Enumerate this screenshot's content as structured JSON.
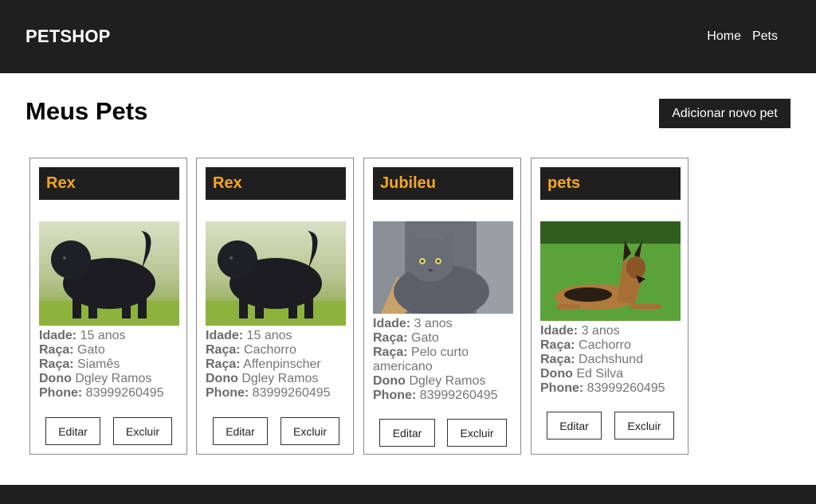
{
  "header": {
    "brand": "PETSHOP",
    "nav": [
      "Home",
      "Pets"
    ]
  },
  "main": {
    "title": "Meus Pets",
    "add_button": "Adicionar novo pet"
  },
  "labels": {
    "idade": "Idade:",
    "raca": "Raça:",
    "dono": "Dono",
    "phone": "Phone:",
    "edit": "Editar",
    "delete": "Excluir"
  },
  "pets": [
    {
      "name": "Rex",
      "photo": "black-shaggy-dog-photo",
      "idade": "15 anos",
      "tipo": "Gato",
      "raca": "Siamês",
      "dono": "Dgley Ramos",
      "phone": "83999260495"
    },
    {
      "name": "Rex",
      "photo": "black-shaggy-dog-photo",
      "idade": "15 anos",
      "tipo": "Cachorro",
      "raca": "Affenpinscher",
      "dono": "Dgley Ramos",
      "phone": "83999260495"
    },
    {
      "name": "Jubileu",
      "photo": "grey-cat-photo",
      "idade": "3 anos",
      "tipo": "Gato",
      "raca": "Pelo curto americano",
      "dono": "Dgley Ramos",
      "phone": "83999260495"
    },
    {
      "name": "pets",
      "photo": "german-shepherd-photo",
      "idade": "3 anos",
      "tipo": "Cachorro",
      "raca": "Dachshund",
      "dono": "Ed Silva",
      "phone": "83999260495"
    }
  ],
  "colors": {
    "bar": "#1f1f1f",
    "pet_name": "#f5a623",
    "info_text": "#757575"
  }
}
